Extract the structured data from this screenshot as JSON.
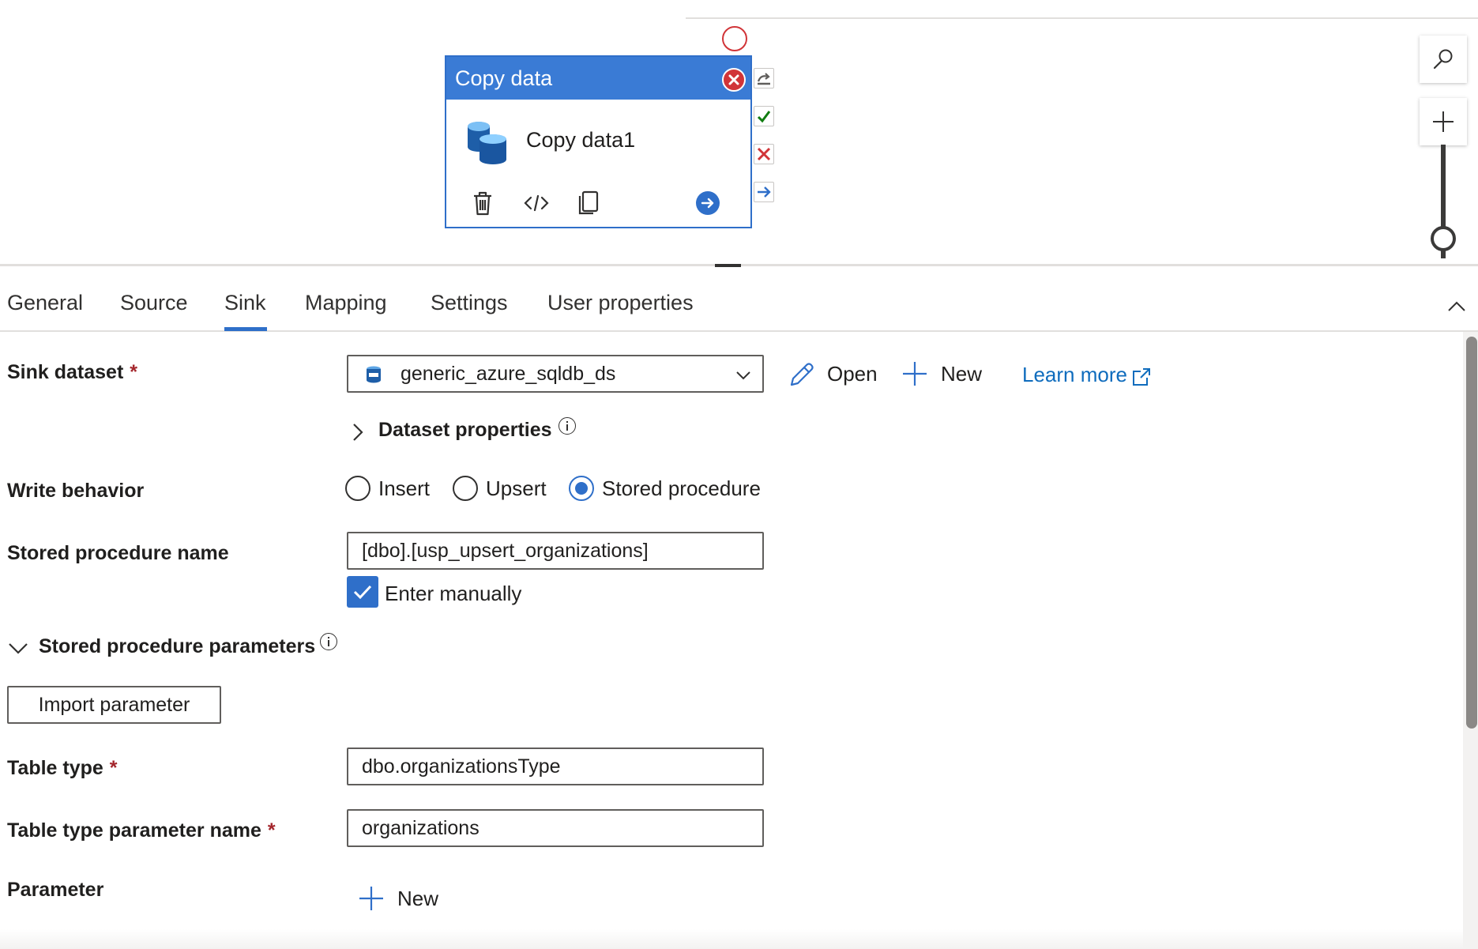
{
  "colors": {
    "accent": "#2f6fc9",
    "header_blue": "#3a7bd5",
    "error_red": "#d13438",
    "success_green": "#107c10",
    "link_blue": "#0f6cbd",
    "required": "#a4262c"
  },
  "canvas": {
    "activity": {
      "type_label": "Copy data",
      "name": "Copy data1",
      "icon": "database-stack-icon",
      "tools": [
        "trash-icon",
        "code-icon",
        "copy-icon",
        "arrow-right-circle-icon"
      ]
    },
    "ports": [
      "skip-redo-icon",
      "success-check-icon",
      "failure-x-icon",
      "completion-arrow-icon"
    ],
    "zoom": {
      "search_icon": "search-icon",
      "zoom_in_icon": "plus-icon"
    }
  },
  "tabs": [
    {
      "label": "General"
    },
    {
      "label": "Source"
    },
    {
      "label": "Sink",
      "selected": true
    },
    {
      "label": "Mapping"
    },
    {
      "label": "Settings"
    },
    {
      "label": "User properties"
    }
  ],
  "form": {
    "sink_dataset": {
      "label": "Sink dataset",
      "required_mark": "*",
      "value": "generic_azure_sqldb_ds",
      "icon": "sql-database-icon",
      "open_label": "Open",
      "new_label": "New",
      "learn_more_label": "Learn more"
    },
    "dataset_properties": {
      "label": "Dataset properties",
      "expanded": false
    },
    "write_behavior": {
      "label": "Write behavior",
      "options": [
        {
          "label": "Insert",
          "selected": false
        },
        {
          "label": "Upsert",
          "selected": false
        },
        {
          "label": "Stored procedure",
          "selected": true
        }
      ]
    },
    "stored_procedure_name": {
      "label": "Stored procedure name",
      "value": "[dbo].[usp_upsert_organizations]",
      "enter_manually_label": "Enter manually",
      "enter_manually_checked": true
    },
    "stored_procedure_parameters": {
      "label": "Stored procedure parameters",
      "expanded": true,
      "import_label": "Import parameter"
    },
    "table_type": {
      "label": "Table type",
      "required_mark": "*",
      "value": "dbo.organizationsType"
    },
    "table_type_parameter_name": {
      "label": "Table type parameter name",
      "required_mark": "*",
      "value": "organizations"
    },
    "parameter": {
      "label": "Parameter",
      "new_label": "New"
    }
  }
}
